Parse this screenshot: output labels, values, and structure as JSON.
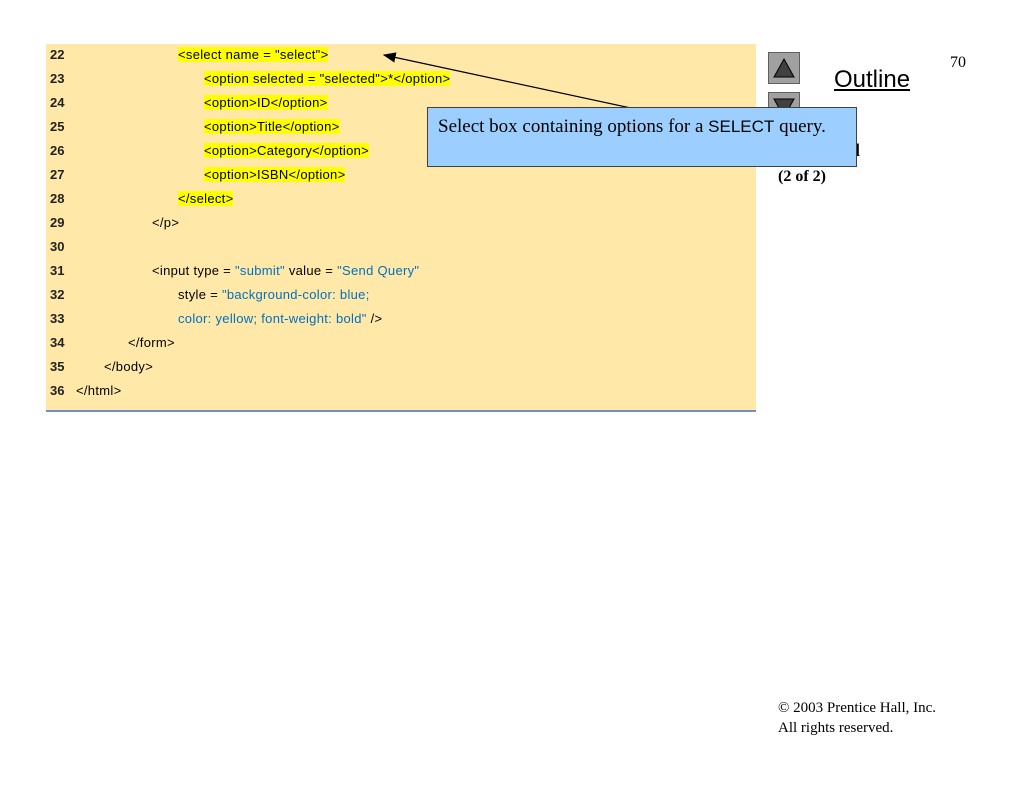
{
  "page_number": "70",
  "outline_title": "Outline",
  "side_label_fragment": "l",
  "side_label": "(2 of 2)",
  "callout": {
    "text_before": "Select box containing options for a ",
    "keyword": "SELECT",
    "text_after": " query."
  },
  "copyright": {
    "line1": "© 2003 Prentice Hall, Inc.",
    "line2": "All rights reserved."
  },
  "code_lines": [
    {
      "num": "22",
      "segments": [
        {
          "t": "<select name = \"select\">",
          "c": "hl"
        }
      ]
    },
    {
      "num": "23",
      "segments": [
        {
          "t": "<option selected = ",
          "c": "hl"
        },
        {
          "t": "\"selected\"",
          "c": "hl-str"
        },
        {
          "t": ">*</option>",
          "c": "hl"
        }
      ]
    },
    {
      "num": "24",
      "segments": [
        {
          "t": "<option>ID</option>",
          "c": "hl"
        }
      ]
    },
    {
      "num": "25",
      "segments": [
        {
          "t": "<option>Title</option>",
          "c": "hl"
        }
      ]
    },
    {
      "num": "26",
      "segments": [
        {
          "t": "<option>Category</option>",
          "c": "hl"
        }
      ]
    },
    {
      "num": "27",
      "segments": [
        {
          "t": "<option>ISBN</option>",
          "c": "hl"
        }
      ]
    },
    {
      "num": "28",
      "segments": [
        {
          "t": "</select>",
          "c": "hl"
        }
      ]
    },
    {
      "num": "29",
      "segments": [
        {
          "t": "</p>",
          "c": "plain"
        }
      ]
    },
    {
      "num": "30",
      "segments": []
    },
    {
      "num": "31",
      "segments": [
        {
          "t": "<input type = ",
          "c": "plain"
        },
        {
          "t": "\"submit\"",
          "c": "str"
        },
        {
          "t": " value = ",
          "c": "plain"
        },
        {
          "t": "\"Send Query\"",
          "c": "str"
        }
      ]
    },
    {
      "num": "32",
      "segments": [
        {
          "t": "style = ",
          "c": "plain"
        },
        {
          "t": "\"background-color: blue;",
          "c": "str"
        }
      ]
    },
    {
      "num": "33",
      "segments": [
        {
          "t": "color: yellow; font-weight: bold\"",
          "c": "str"
        },
        {
          "t": " />",
          "c": "plain"
        }
      ]
    },
    {
      "num": "34",
      "segments": [
        {
          "t": "</form>",
          "c": "plain"
        }
      ]
    },
    {
      "num": "35",
      "segments": [
        {
          "t": "</body>",
          "c": "plain"
        }
      ]
    },
    {
      "num": "36",
      "segments": [
        {
          "t": "</html>",
          "c": "plain"
        }
      ]
    }
  ],
  "icons": {
    "up": "triangle-up-icon",
    "down": "triangle-down-icon"
  },
  "colors": {
    "code_bg": "#ffe8a8",
    "highlight": "#ffff00",
    "string": "#0070c0",
    "callout_bg": "#9ccfff"
  }
}
